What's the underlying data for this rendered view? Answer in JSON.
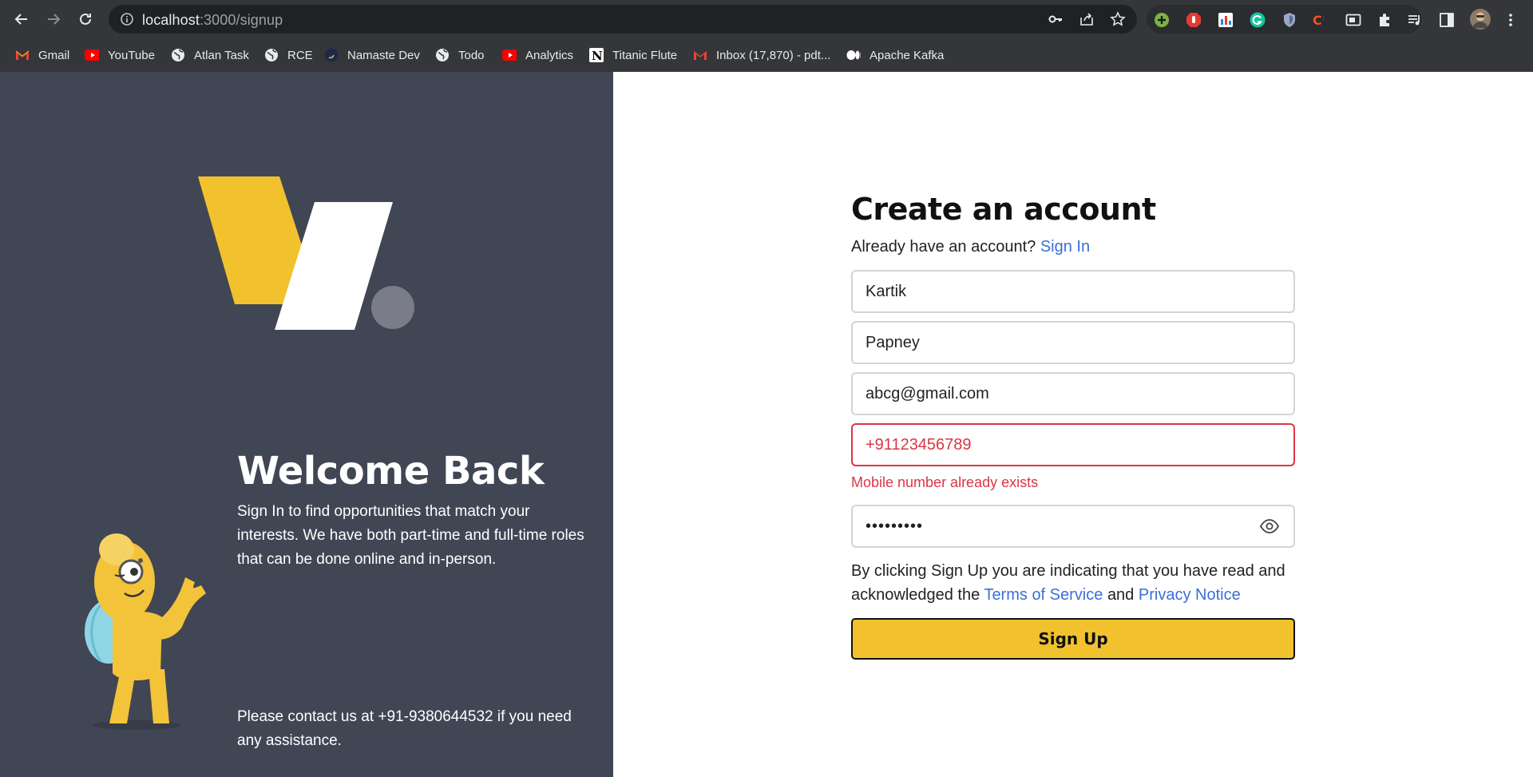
{
  "browser": {
    "url_host": "localhost",
    "url_path": ":3000/signup",
    "bookmarks": [
      {
        "label": "Gmail",
        "icon": "gmail-icon"
      },
      {
        "label": "YouTube",
        "icon": "youtube-icon"
      },
      {
        "label": "Atlan Task",
        "icon": "globe-icon"
      },
      {
        "label": "RCE",
        "icon": "globe-icon"
      },
      {
        "label": "Namaste Dev",
        "icon": "namaste-dev-icon"
      },
      {
        "label": "Todo",
        "icon": "globe-icon"
      },
      {
        "label": "Analytics",
        "icon": "youtube-icon"
      },
      {
        "label": "Titanic Flute",
        "icon": "notion-icon"
      },
      {
        "label": "Inbox (17,870) - pdt...",
        "icon": "gmail-icon"
      },
      {
        "label": "Apache Kafka",
        "icon": "medium-icon"
      }
    ]
  },
  "left_panel": {
    "welcome_title": "Welcome Back",
    "welcome_text": "Sign In to find opportunities that match your interests. We have both part-time and full-time roles that can be done online and in-person.",
    "contact_text": "Please contact us at +91-9380644532 if you need any assistance.",
    "colors": {
      "background": "#414655",
      "logo_yellow": "#f1c22e",
      "logo_white": "#ffffff",
      "logo_dot": "#7a7d89"
    }
  },
  "form": {
    "title": "Create an account",
    "already_text": "Already have an account?",
    "signin_link": "Sign In",
    "first_name": "Kartik",
    "last_name": "Papney",
    "email": "abcg@gmail.com",
    "phone": "+91123456789",
    "phone_error": "Mobile number already exists",
    "password_masked": "•••••••••",
    "terms_prefix": "By clicking Sign Up you are indicating that you have read and acknowledged the",
    "terms_link": "Terms of Service",
    "terms_and": "and",
    "privacy_link": "Privacy Notice",
    "submit_label": "Sign Up",
    "colors": {
      "accent": "#f1c22e",
      "link": "#3b6fd6",
      "error": "#dc3545"
    }
  }
}
